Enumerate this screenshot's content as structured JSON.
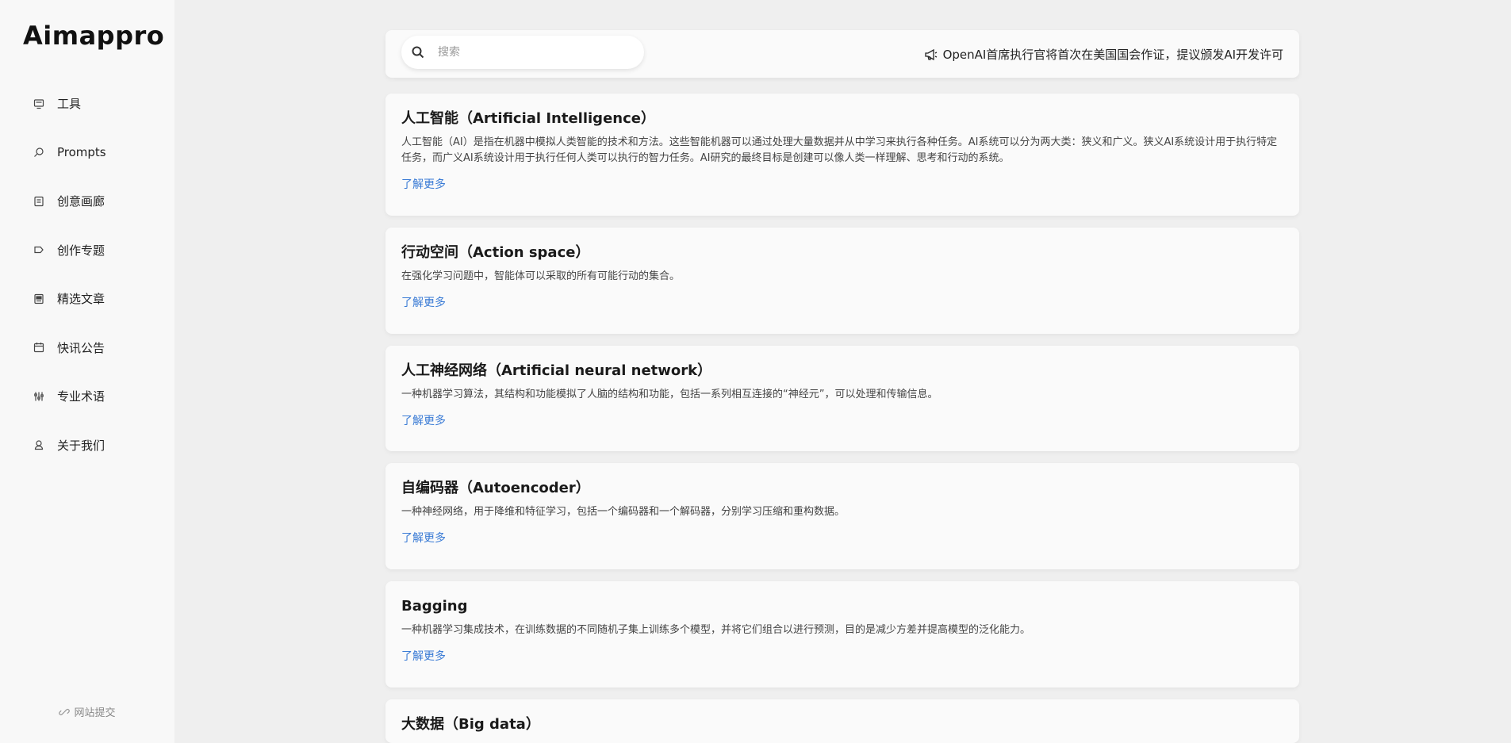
{
  "sidebar": {
    "logo": "Aimappro",
    "items": [
      {
        "label": "工具",
        "icon": "monitor-icon"
      },
      {
        "label": "Prompts",
        "icon": "search-icon"
      },
      {
        "label": "创意画廊",
        "icon": "gallery-icon"
      },
      {
        "label": "创作专题",
        "icon": "tag-icon"
      },
      {
        "label": "精选文章",
        "icon": "article-icon"
      },
      {
        "label": "快讯公告",
        "icon": "calendar-icon"
      },
      {
        "label": "专业术语",
        "icon": "sliders-icon"
      },
      {
        "label": "关于我们",
        "icon": "user-icon"
      }
    ],
    "submit_label": "网站提交"
  },
  "topbar": {
    "search_placeholder": "搜索",
    "news_text": "OpenAI首席执行官将首次在美国国会作证，提议颁发AI开发许可"
  },
  "terms": [
    {
      "title": "人工智能（Artificial Intelligence）",
      "description": "人工智能（AI）是指在机器中模拟人类智能的技术和方法。这些智能机器可以通过处理大量数据并从中学习来执行各种任务。AI系统可以分为两大类：狭义和广义。狭义AI系统设计用于执行特定任务，而广义AI系统设计用于执行任何人类可以执行的智力任务。AI研究的最终目标是创建可以像人类一样理解、思考和行动的系统。",
      "link": "了解更多"
    },
    {
      "title": "行动空间（Action space）",
      "description": "在强化学习问题中，智能体可以采取的所有可能行动的集合。",
      "link": "了解更多"
    },
    {
      "title": "人工神经网络（Artificial neural network）",
      "description": "一种机器学习算法，其结构和功能模拟了人脑的结构和功能，包括一系列相互连接的“神经元”，可以处理和传输信息。",
      "link": "了解更多"
    },
    {
      "title": "自编码器（Autoencoder）",
      "description": "一种神经网络，用于降维和特征学习，包括一个编码器和一个解码器，分别学习压缩和重构数据。",
      "link": "了解更多"
    },
    {
      "title": "Bagging",
      "description": "一种机器学习集成技术，在训练数据的不同随机子集上训练多个模型，并将它们组合以进行预测，目的是减少方差并提高模型的泛化能力。",
      "link": "了解更多"
    },
    {
      "title": "大数据（Big data）",
      "description": "",
      "link": ""
    }
  ],
  "colors": {
    "link": "#3a7bd5",
    "background": "#efefef",
    "sidebar": "#f8f8f8",
    "card": "#fafafa"
  }
}
